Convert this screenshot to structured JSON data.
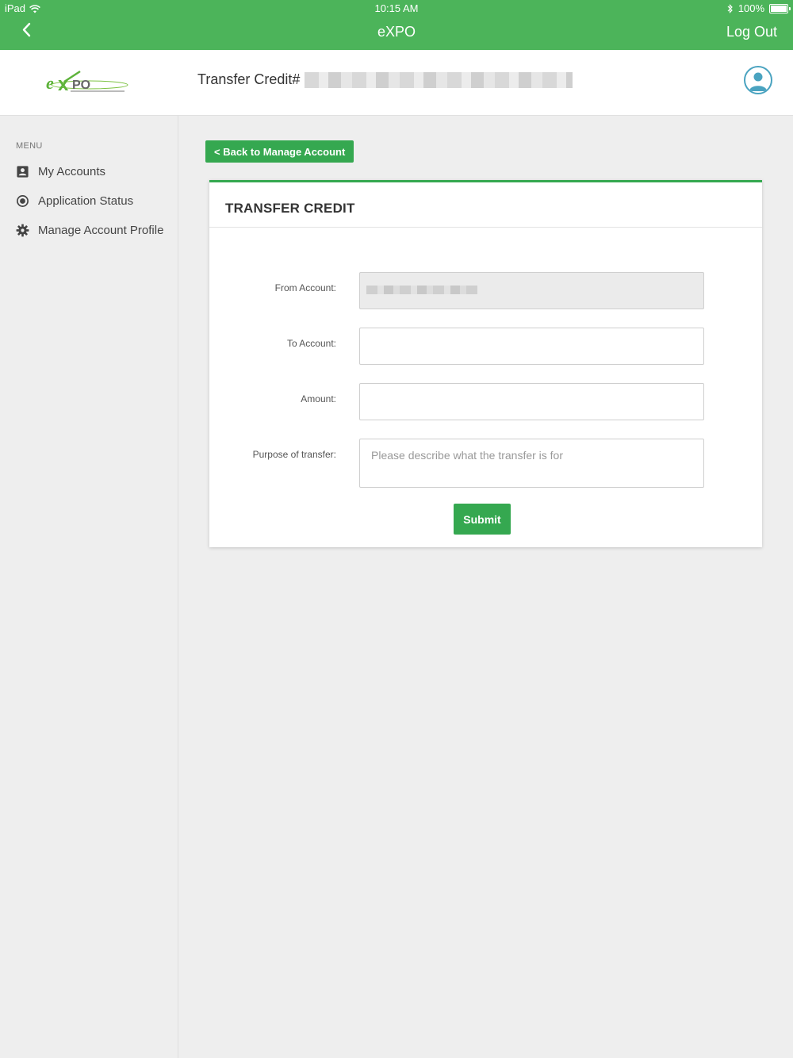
{
  "status_bar": {
    "device": "iPad",
    "time": "10:15 AM",
    "battery": "100%"
  },
  "nav": {
    "title": "eXPO",
    "logout_label": "Log Out"
  },
  "header": {
    "page_title": "Transfer Credit#"
  },
  "sidebar": {
    "menu_label": "MENU",
    "items": [
      {
        "label": "My Accounts",
        "icon": "account-box-icon"
      },
      {
        "label": "Application Status",
        "icon": "radio-circle-icon"
      },
      {
        "label": "Manage Account Profile",
        "icon": "gear-icon"
      }
    ]
  },
  "main": {
    "back_button_label": "< Back to Manage Account",
    "card_title": "TRANSFER CREDIT",
    "form": {
      "from_account_label": "From Account:",
      "to_account_label": "To Account:",
      "amount_label": "Amount:",
      "purpose_label": "Purpose of transfer:",
      "purpose_placeholder": "Please describe what the transfer is for",
      "submit_label": "Submit"
    }
  },
  "colors": {
    "brand_green": "#4cb45a",
    "button_green": "#35a850",
    "avatar_blue": "#4aa3c0"
  }
}
